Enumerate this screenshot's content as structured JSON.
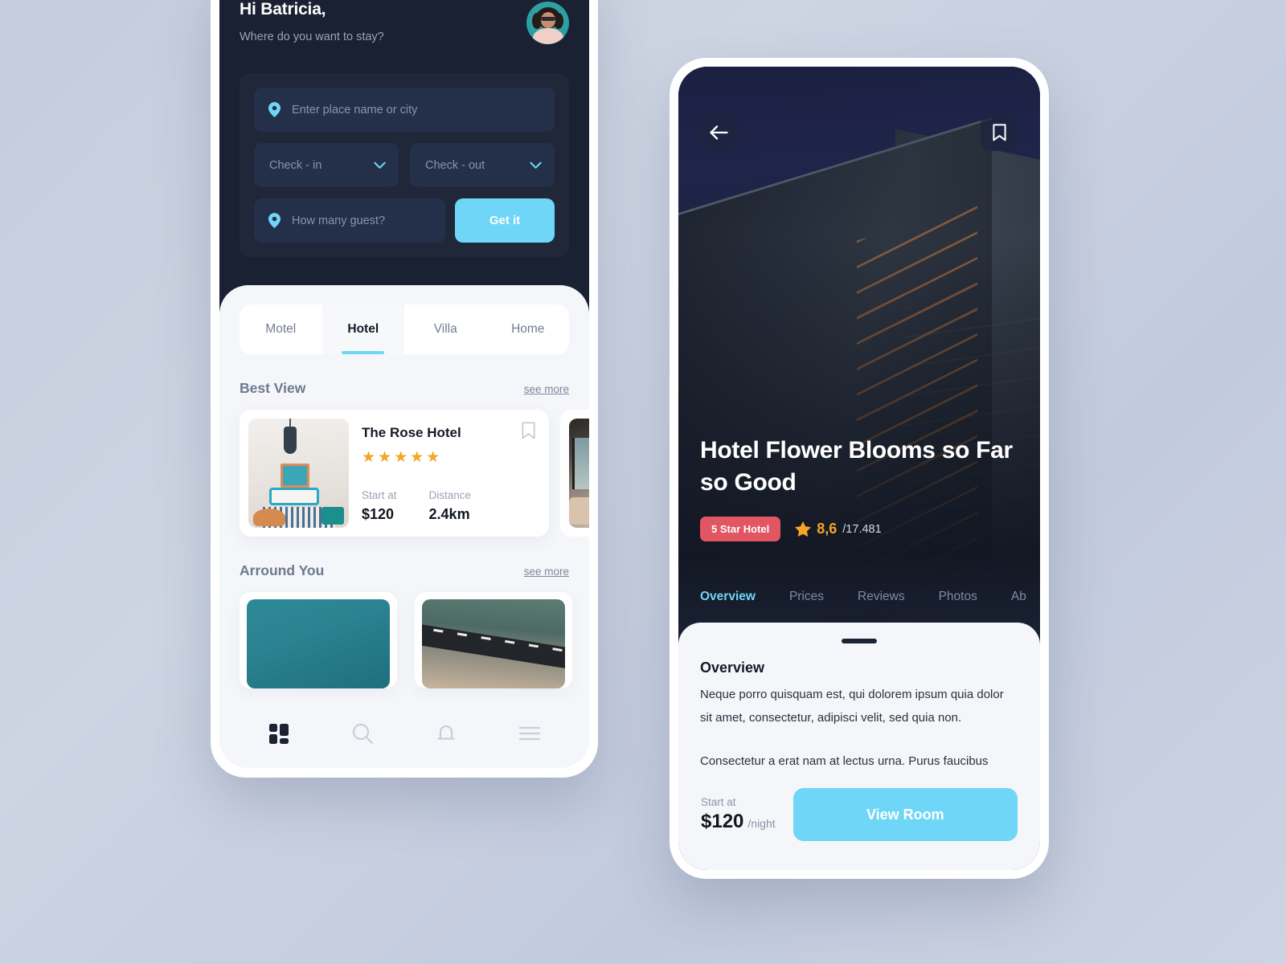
{
  "home_screen": {
    "greeting": "Hi Batricia,",
    "subtitle": "Where do you want to stay?",
    "avatar_alt": "user-avatar",
    "search": {
      "place_placeholder": "Enter place name or city",
      "checkin_label": "Check - in",
      "checkout_label": "Check - out",
      "guest_placeholder": "How many guest?",
      "submit_label": "Get it"
    },
    "category_tabs": [
      {
        "label": "Motel",
        "active": false
      },
      {
        "label": "Hotel",
        "active": true
      },
      {
        "label": "Villa",
        "active": false
      },
      {
        "label": "Home",
        "active": false
      }
    ],
    "best_view": {
      "section_title": "Best View",
      "see_more": "see more",
      "cards": [
        {
          "title": "The Rose Hotel",
          "stars": "★★★★★",
          "start_at_label": "Start at",
          "price": "$120",
          "distance_label": "Distance",
          "distance": "2.4km"
        }
      ]
    },
    "around_you": {
      "section_title": "Arround You",
      "see_more": "see more"
    },
    "bottom_nav": [
      {
        "icon": "dashboard-icon",
        "active": true
      },
      {
        "icon": "search-icon",
        "active": false
      },
      {
        "icon": "bell-icon",
        "active": false
      },
      {
        "icon": "menu-icon",
        "active": false
      }
    ]
  },
  "detail_screen": {
    "back_icon": "arrow-left-icon",
    "bookmark_icon": "bookmark-icon",
    "hotel_name": "Hotel Flower Blooms so Far so Good",
    "badge": "5 Star Hotel",
    "rating_value": "8,6",
    "rating_count": "/17.481",
    "tabs": [
      {
        "label": "Overview",
        "active": true
      },
      {
        "label": "Prices",
        "active": false
      },
      {
        "label": "Reviews",
        "active": false
      },
      {
        "label": "Photos",
        "active": false
      },
      {
        "label": "Ab",
        "active": false
      }
    ],
    "overview": {
      "title": "Overview",
      "paragraph_1": "Neque porro quisquam est, qui dolorem ipsum quia dolor sit amet, consectetur, adipisci velit, sed quia non.",
      "paragraph_2": "Consectetur a erat nam at lectus urna. Purus faucibus ornare suspendisse sed nisi. Libero justo laoreet sit amet cursus sit amet. Feugiat pretium nibh ipsum"
    },
    "cta": {
      "price_label": "Start at",
      "price": "$120",
      "per": "/night",
      "button": "View Room"
    }
  },
  "colors": {
    "accent_blue": "#6fd6f7",
    "dark_navy": "#1a2133",
    "badge_red": "#e25563",
    "star_gold": "#f5a623",
    "page_bg": "#c8d0e0"
  }
}
